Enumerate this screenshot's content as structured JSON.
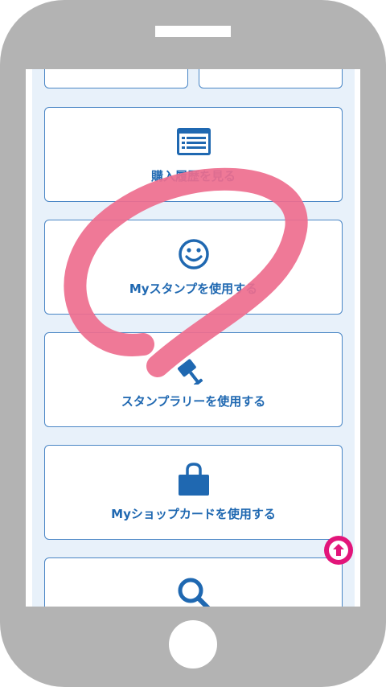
{
  "menu": {
    "items": [
      {
        "label": "",
        "icon": "partial-card"
      },
      {
        "label": "",
        "icon": "partial-card"
      },
      {
        "label": "購入履歴を見る",
        "icon": "list-icon"
      },
      {
        "label": "Myスタンプを使用する",
        "icon": "smiley-icon"
      },
      {
        "label": "スタンプラリーを使用する",
        "icon": "stamp-icon"
      },
      {
        "label": "Myショップカードを使用する",
        "icon": "shopping-bag-icon"
      },
      {
        "label": "",
        "icon": "search-icon"
      }
    ]
  },
  "colors": {
    "accent": "#1f68b1",
    "card_border": "#4a86c5",
    "screen_bg": "#e8f1fa",
    "scroll_top": "#e2157a",
    "scribble": "#ee6e8e",
    "frame": "#b3b3b3"
  }
}
